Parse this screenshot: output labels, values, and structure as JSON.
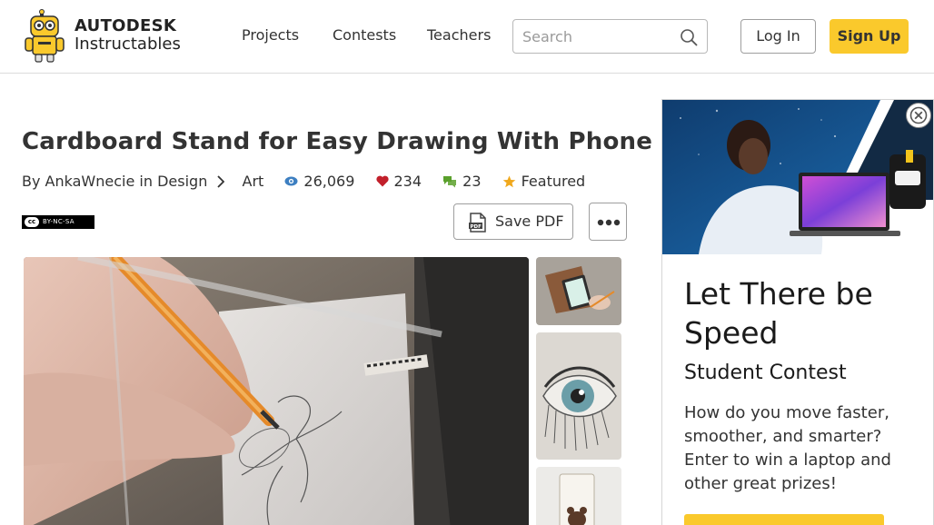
{
  "header": {
    "logo": {
      "line1": "AUTODESK",
      "line2": "Instructables"
    },
    "nav": [
      {
        "label": "Projects"
      },
      {
        "label": "Contests"
      },
      {
        "label": "Teachers"
      }
    ],
    "search": {
      "placeholder": "Search",
      "value": ""
    },
    "login_label": "Log In",
    "signup_label": "Sign Up",
    "colors": {
      "accent": "#fac92c"
    }
  },
  "article": {
    "title": "Cardboard Stand for Easy Drawing With Phone",
    "author_prefix": "By",
    "author": "AnkaWnecie",
    "category_prefix": "in",
    "category": "Design",
    "subcategory": "Art",
    "views": "26,069",
    "favorites": "234",
    "comments": "23",
    "featured_label": "Featured",
    "license": "BY-NC-SA",
    "license_cc": "cc",
    "save_pdf_label": "Save PDF",
    "icons": [
      "eye-icon",
      "heart-icon",
      "comment-icon",
      "star-icon",
      "pdf-icon",
      "more-dots-icon"
    ],
    "stat_colors": {
      "views": "#3d7fc1",
      "favorites": "#c2202b",
      "comments": "#5aa02c",
      "featured": "#f0a81c"
    }
  },
  "ad": {
    "title": "Let There be Speed",
    "subtitle": "Student Contest",
    "body": "How do you move faster, smoother, and smarter? Enter to win a laptop and other great prizes!"
  }
}
